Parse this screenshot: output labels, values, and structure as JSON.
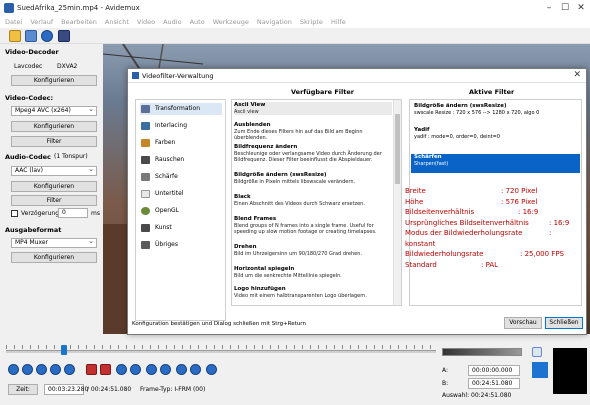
{
  "window": {
    "title": "SuedAfrika_25min.mp4 - Avidemux"
  },
  "menu": [
    "Datei",
    "Verlauf",
    "Bearbeiten",
    "Ansicht",
    "Video",
    "Audio",
    "Auto",
    "Werkzeuge",
    "Navigation",
    "Skripte",
    "Hilfe"
  ],
  "left": {
    "video_decoder": {
      "title": "Video-Decoder",
      "lavcodec": "Lavcodec",
      "codec": "DXVA2",
      "configure": "Konfigurieren"
    },
    "video_codec": {
      "title": "Video-Codec:",
      "value": "Mpeg4 AVC (x264)",
      "configure": "Konfigurieren",
      "filter": "Filter"
    },
    "audio_codec": {
      "title": "Audio-Codec",
      "tracks": "(1 Tonspur)",
      "value": "AAC (lav)",
      "configure": "Konfigurieren",
      "filter": "Filter",
      "delay_label": "Verzögerung:",
      "delay_value": "0",
      "delay_unit": "ms"
    },
    "output_format": {
      "title": "Ausgabeformat",
      "value": "MP4 Muxer",
      "configure": "Konfigurieren"
    }
  },
  "dialog": {
    "title": "Videofilter-Verwaltung",
    "available_header": "Verfügbare Filter",
    "active_header": "Aktive Filter",
    "categories": [
      {
        "label": "Transformation",
        "icon": "transform-icon",
        "color": "#5a6f9a"
      },
      {
        "label": "Interlacing",
        "icon": "interlacing-icon",
        "color": "#3a6e9e"
      },
      {
        "label": "Farben",
        "icon": "colors-icon",
        "color": "#c8862a"
      },
      {
        "label": "Rauschen",
        "icon": "noise-icon",
        "color": "#4a4a4a"
      },
      {
        "label": "Schärfe",
        "icon": "sharpness-icon",
        "color": "#7a7a7a"
      },
      {
        "label": "Untertitel",
        "icon": "subtitle-icon",
        "color": "#e8e8e8"
      },
      {
        "label": "OpenGL",
        "icon": "opengl-icon",
        "color": "#6a8a3a"
      },
      {
        "label": "Kunst",
        "icon": "art-icon",
        "color": "#4a4a4a"
      },
      {
        "label": "Übriges",
        "icon": "misc-icon",
        "color": "#5a5a5a"
      }
    ],
    "filters": [
      {
        "name": "Ascii View",
        "desc": "Ascii view"
      },
      {
        "name": "Ausblenden",
        "desc": "Zum Ende dieses Filters hin auf das Bild am Beginn überblenden."
      },
      {
        "name": "Bildfrequenz ändern",
        "desc": "Beschleunige oder verlangsame Video durch Änderung der Bildfrequenz. Dieser Filter beeinflusst die Abspieldauer."
      },
      {
        "name": "Bildgröße ändern (swsResize)",
        "desc": "Bildgröße in Pixeln mittels libswscale verändern."
      },
      {
        "name": "Black",
        "desc": "Einen Abschnitt des Videos durch Schwarz ersetzen."
      },
      {
        "name": "Blend Frames",
        "desc": "Blend groups of N frames into a single frame.  Useful for speeding up slow motion footage or creating timelapses."
      },
      {
        "name": "Drehen",
        "desc": "Bild im Uhrzeigersinn um 90/180/270 Grad drehen."
      },
      {
        "name": "Horizontal spiegeln",
        "desc": "Bild um die senkrechte Mittellinie spiegeln."
      },
      {
        "name": "Logo hinzufügen",
        "desc": "Video mit einem halbtransparenten Logo überlagern."
      }
    ],
    "active_filters": [
      {
        "name": "Bildgröße ändern (swsResize)",
        "desc": "swscale Resize : 720 x 576  --> 1280 x 720, algo 0"
      },
      {
        "name": "Yadif",
        "desc": "yadif : mode=0, order=0, deint=0"
      },
      {
        "name": "Schärfen",
        "desc": "Sharpen(fast)"
      }
    ],
    "footer_text": "Konfiguration bestätigen und Dialog schließen mit Strg+Return",
    "preview_button": "Vorschau",
    "close_button": "Schließen"
  },
  "info": [
    {
      "label": "Breite",
      "value": ": 720 Pixel"
    },
    {
      "label": "Höhe",
      "value": ": 576 Pixel"
    },
    {
      "label": "Bildseitenverhältnis",
      "value": ": 16:9"
    },
    {
      "label": "Ursprüngliches Bildseitenverhältnis",
      "value": ": 16:9"
    },
    {
      "label": "Modus der Bildwiederholungsrate",
      "value": ":"
    },
    {
      "label": "konstant",
      "value": ""
    },
    {
      "label": "Bildwiederholungsrate",
      "value": ": 25,000 FPS"
    },
    {
      "label": "Standard",
      "value": ": PAL"
    }
  ],
  "bottom": {
    "time_button": "Zeit:",
    "current_time": "00:03:23.280",
    "total_time": "/ 00:24:51.080",
    "frame_type": "Frame-Typ:  I-FRM (00)",
    "a_label": "A:",
    "a_value": "00:00:00.000",
    "b_label": "B:",
    "b_value": "00:24:51.080",
    "selection": "Auswahl: 00:24:51.080",
    "playhead_fraction": 0.136
  },
  "colors": {
    "accent": "#0a64c8",
    "info_text": "#c00000"
  }
}
